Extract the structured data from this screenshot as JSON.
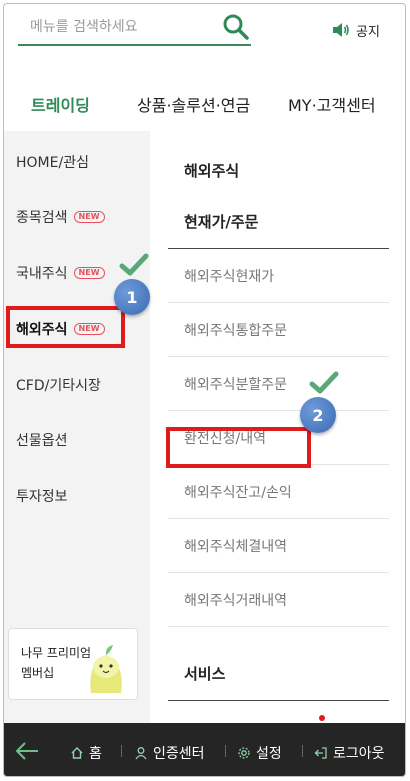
{
  "search": {
    "placeholder": "메뉴를 검색하세요"
  },
  "notice": {
    "label": "공지"
  },
  "tabs": [
    {
      "label": "트레이딩",
      "active": true
    },
    {
      "label": "상품·솔루션·연금",
      "active": false
    },
    {
      "label": "MY·고객센터",
      "active": false
    }
  ],
  "sidebar": {
    "items": [
      {
        "label": "HOME/관심",
        "badge": ""
      },
      {
        "label": "종목검색",
        "badge": "NEW"
      },
      {
        "label": "국내주식",
        "badge": "NEW"
      },
      {
        "label": "해외주식",
        "badge": "NEW"
      },
      {
        "label": "CFD/기타시장",
        "badge": ""
      },
      {
        "label": "선물옵션",
        "badge": ""
      },
      {
        "label": "투자정보",
        "badge": ""
      }
    ],
    "promo": {
      "text": "나무 프리미엄\n멤버십"
    }
  },
  "content": {
    "header": "해외주식",
    "group_title": "현재가/주문",
    "menu": [
      "해외주식현재가",
      "해외주식통합주문",
      "해외주식분할주문",
      "환전신청/내역",
      "해외주식잔고/손익",
      "해외주식체결내역",
      "해외주식거래내역"
    ],
    "services_title": "서비스"
  },
  "steps": {
    "one": "1",
    "two": "2"
  },
  "bottombar": {
    "home": "홈",
    "auth": "인증센터",
    "settings": "설정",
    "logout": "로그아웃"
  },
  "colors": {
    "accent": "#2e8b57",
    "highlight": "#e01b1b",
    "step": "#4a7bc4",
    "bar": "#252525"
  }
}
